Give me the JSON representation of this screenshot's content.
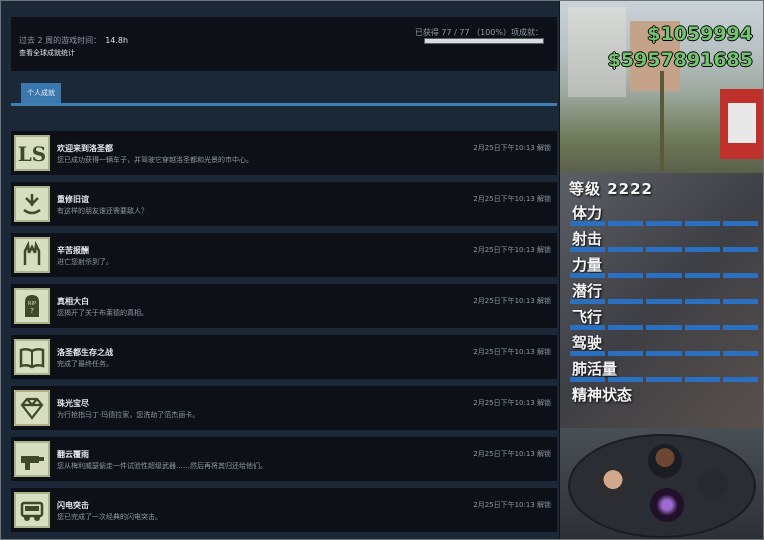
{
  "summary": {
    "playtime_label": "过去 2 周的游戏时间：",
    "playtime_value": "14.8h",
    "global_link": "查看全球成就统计",
    "progress_text": "已获得 77 / 77 （100%）项成就：",
    "progress_fraction": 1.0
  },
  "tabs": [
    {
      "label": "个人成就"
    }
  ],
  "achievements": [
    {
      "icon": "ls-logo-icon",
      "title": "欢迎来到洛圣都",
      "desc": "您已成功获得一辆车子，并驾驶它穿越洛圣都和光景的市中心。",
      "date": "2月25日下午10:13 解锁"
    },
    {
      "icon": "handshake-icon",
      "title": "重修旧谊",
      "desc": "有这样的朋友谁还需要敌人？",
      "date": "2月25日下午10:13 解锁"
    },
    {
      "icon": "hands-icon",
      "title": "辛苦报酬",
      "desc": "进亡您射杀到了。",
      "date": "2月25日下午10:13 解锁"
    },
    {
      "icon": "tombstone-icon",
      "title": "真相大白",
      "desc": "您揭开了关于布莱德的真相。",
      "date": "2月25日下午10:13 解锁"
    },
    {
      "icon": "book-icon",
      "title": "洛圣都生存之战",
      "desc": "完成了最终任务。",
      "date": "2月25日下午10:13 解锁"
    },
    {
      "icon": "diamond-icon",
      "title": "珠光宝尽",
      "desc": "为行抢指马丁·玛德拉家，您洗劫了范杰丽卡。",
      "date": "2月25日下午10:13 解锁"
    },
    {
      "icon": "gun-icon",
      "title": "翻云覆雨",
      "desc": "您从梅利威瑟偷走一件试验性超级武器……然后再将其归还给他们。",
      "date": "2月25日下午10:13 解锁"
    },
    {
      "icon": "truck-icon",
      "title": "闪电突击",
      "desc": "您已完成了一次经典的闪电突击。",
      "date": "2月25日下午10:13 解锁"
    }
  ],
  "game_overlay": {
    "money_1": "$1059994",
    "money_2": "$5957891685",
    "level": "等级 2222",
    "stats": [
      {
        "label": "体力",
        "level": 1.0
      },
      {
        "label": "射击",
        "level": 1.0
      },
      {
        "label": "力量",
        "level": 1.0
      },
      {
        "label": "潜行",
        "level": 1.0
      },
      {
        "label": "飞行",
        "level": 1.0
      },
      {
        "label": "驾驶",
        "level": 1.0
      },
      {
        "label": "肺活量",
        "level": 1.0
      },
      {
        "label": "精神状态"
      }
    ]
  },
  "colors": {
    "accent": "#3a78ad",
    "stat_bar": "#2b6fc0",
    "money": "#73c46e"
  }
}
